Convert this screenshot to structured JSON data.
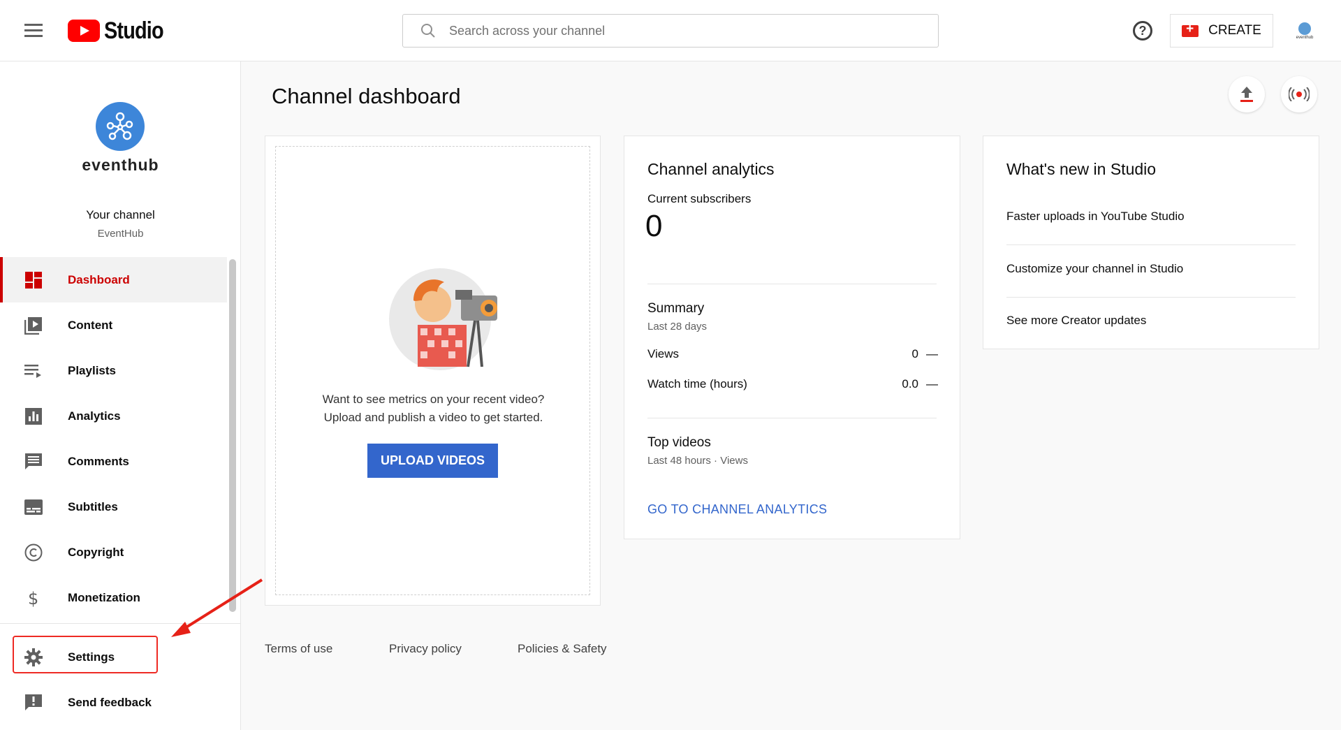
{
  "header": {
    "logo_text": "Studio",
    "search_placeholder": "Search across your channel",
    "help_symbol": "?",
    "create_label": "CREATE",
    "avatar_text": "eventhub"
  },
  "sidebar": {
    "channel_name": "eventhub",
    "your_channel_label": "Your channel",
    "channel_handle": "EventHub",
    "items": [
      {
        "label": "Dashboard",
        "icon": "dashboard-icon",
        "active": true
      },
      {
        "label": "Content",
        "icon": "video-library-icon"
      },
      {
        "label": "Playlists",
        "icon": "playlist-icon"
      },
      {
        "label": "Analytics",
        "icon": "bar-chart-icon"
      },
      {
        "label": "Comments",
        "icon": "comment-icon"
      },
      {
        "label": "Subtitles",
        "icon": "subtitles-icon"
      },
      {
        "label": "Copyright",
        "icon": "copyright-icon"
      },
      {
        "label": "Monetization",
        "icon": "dollar-icon"
      }
    ],
    "bottom_items": [
      {
        "label": "Settings",
        "icon": "gear-icon"
      },
      {
        "label": "Send feedback",
        "icon": "feedback-icon"
      }
    ]
  },
  "main": {
    "title": "Channel dashboard",
    "upload_card": {
      "message_line1": "Want to see metrics on your recent video?",
      "message_line2": "Upload and publish a video to get started.",
      "button_label": "UPLOAD VIDEOS"
    },
    "analytics_card": {
      "title": "Channel analytics",
      "subscribers_label": "Current subscribers",
      "subscribers_value": "0",
      "summary_title": "Summary",
      "summary_period": "Last 28 days",
      "metrics": [
        {
          "label": "Views",
          "value": "0",
          "delta": "—"
        },
        {
          "label": "Watch time (hours)",
          "value": "0.0",
          "delta": "—"
        }
      ],
      "top_videos_title": "Top videos",
      "top_videos_period": "Last 48 hours · Views",
      "link_label": "GO TO CHANNEL ANALYTICS"
    },
    "news_card": {
      "title": "What's new in Studio",
      "items": [
        "Faster uploads in YouTube Studio",
        "Customize your channel in Studio",
        "See more Creator updates"
      ]
    }
  },
  "footer": {
    "links": [
      "Terms of use",
      "Privacy policy",
      "Policies & Safety"
    ]
  },
  "colors": {
    "brand_red": "#ff0000",
    "active_red": "#cc0000",
    "link_blue": "#3366cc",
    "annotation_red": "#ee2a24"
  }
}
